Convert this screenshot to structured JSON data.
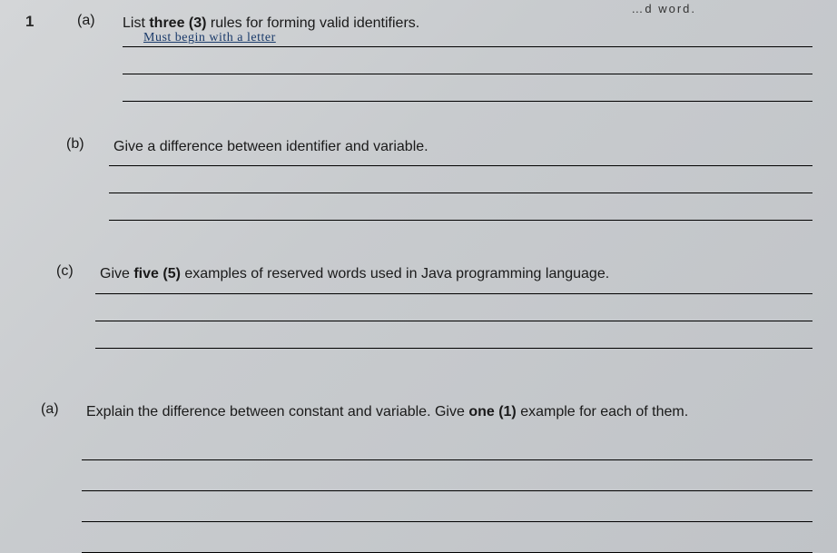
{
  "header_fragment": "…d word.",
  "question_number": "1",
  "parts": {
    "a1": {
      "label": "(a)",
      "text_pre": "List ",
      "text_bold": "three (3)",
      "text_post": " rules for forming valid identifiers.",
      "handwritten": "Must  begin   with  a   letter"
    },
    "b": {
      "label": "(b)",
      "text": "Give a difference between identifier and variable."
    },
    "c": {
      "label": "(c)",
      "text_pre": "Give ",
      "text_bold": "five (5)",
      "text_post": " examples of reserved words used in Java programming language."
    },
    "a2": {
      "label": "(a)",
      "text_pre": "Explain the difference between constant and variable. Give ",
      "text_bold": "one (1)",
      "text_post": " example for each of them."
    }
  }
}
